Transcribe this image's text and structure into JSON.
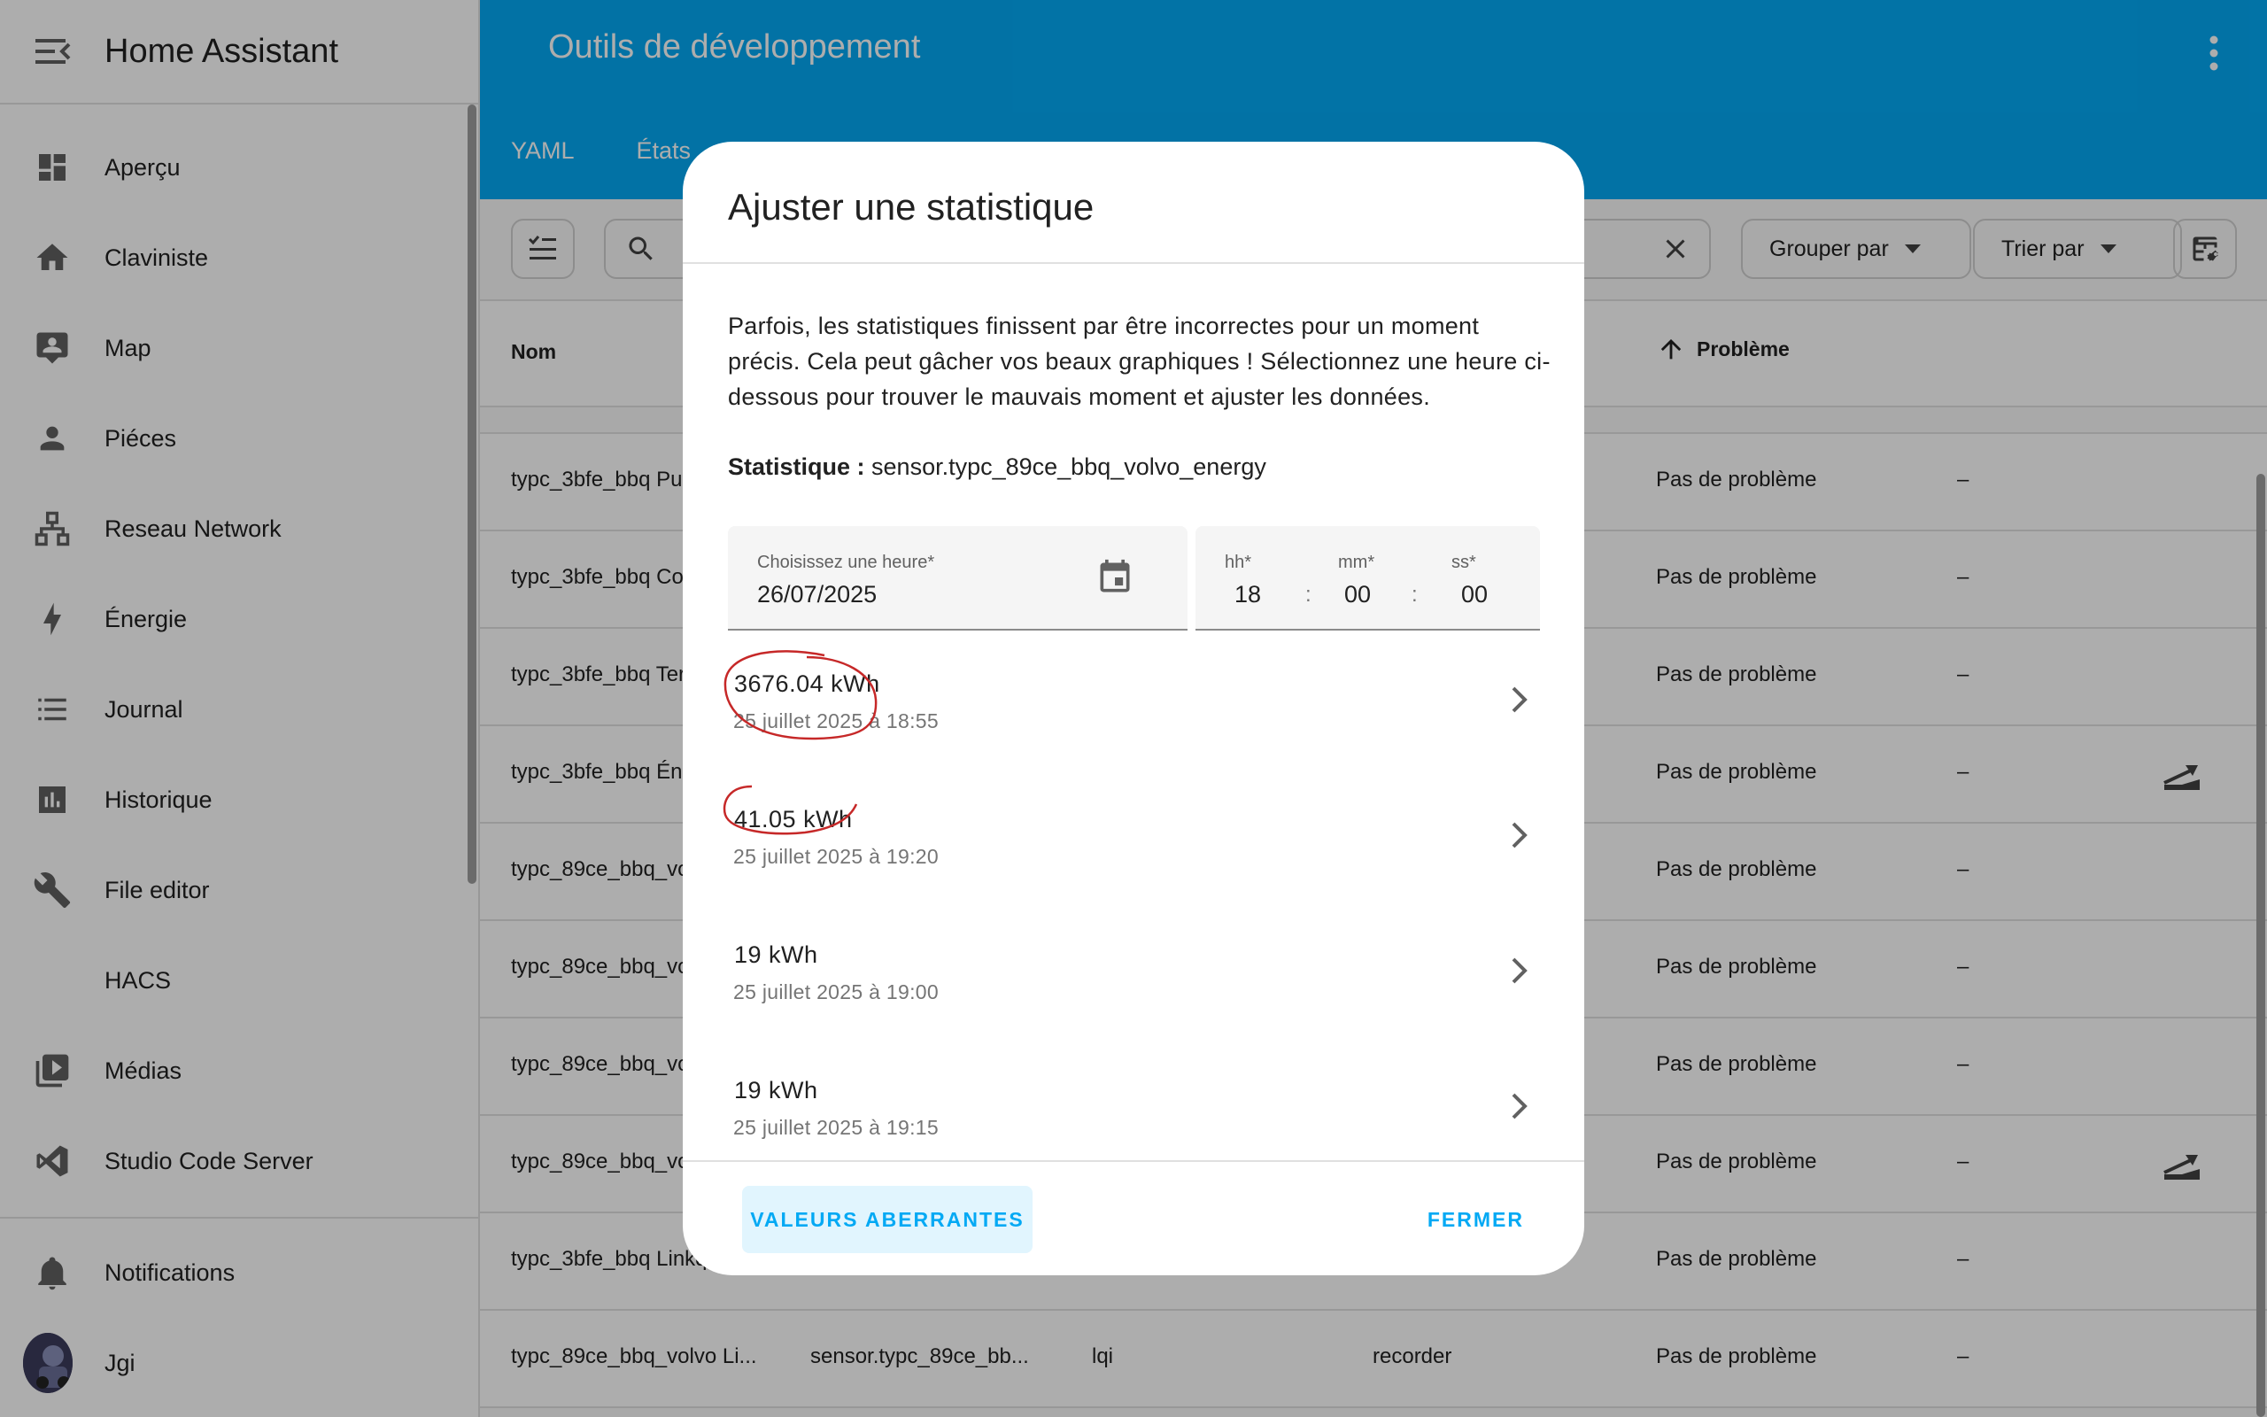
{
  "app_title": "Home Assistant",
  "header": {
    "title": "Outils de développement",
    "tabs": [
      "YAML",
      "États"
    ]
  },
  "sidebar": {
    "items": [
      {
        "label": "Aperçu",
        "icon": "dashboard-icon"
      },
      {
        "label": "Claviniste",
        "icon": "home-icon"
      },
      {
        "label": "Map",
        "icon": "map-account-icon"
      },
      {
        "label": "Piéces",
        "icon": "person-icon"
      },
      {
        "label": "Reseau Network",
        "icon": "network-icon"
      },
      {
        "label": "Énergie",
        "icon": "lightning-icon"
      },
      {
        "label": "Journal",
        "icon": "list-icon"
      },
      {
        "label": "Historique",
        "icon": "chart-icon"
      },
      {
        "label": "File editor",
        "icon": "wrench-icon"
      },
      {
        "label": "HACS",
        "icon": ""
      },
      {
        "label": "Médias",
        "icon": "media-icon"
      },
      {
        "label": "Studio Code Server",
        "icon": "vscode-icon"
      }
    ],
    "notifications": "Notifications",
    "user": "Jgi"
  },
  "toolbar": {
    "group_by": "Grouper par",
    "sort_by": "Trier par"
  },
  "table": {
    "headers": {
      "name": "Nom",
      "problem": "Problème"
    },
    "rows": [
      {
        "name": "typc_3bfe_bbq Pu",
        "entity": "",
        "unit": "",
        "source": "",
        "problem": "Pas de problème",
        "extra": "–",
        "action": false
      },
      {
        "name": "typc_3bfe_bbq Co",
        "entity": "",
        "unit": "",
        "source": "",
        "problem": "Pas de problème",
        "extra": "–",
        "action": false
      },
      {
        "name": "typc_3bfe_bbq Ter",
        "entity": "",
        "unit": "",
        "source": "",
        "problem": "Pas de problème",
        "extra": "–",
        "action": false
      },
      {
        "name": "typc_3bfe_bbq Éne",
        "entity": "",
        "unit": "",
        "source": "",
        "problem": "Pas de problème",
        "extra": "–",
        "action": true
      },
      {
        "name": "typc_89ce_bbq_vo",
        "entity": "",
        "unit": "",
        "source": "",
        "problem": "Pas de problème",
        "extra": "–",
        "action": false
      },
      {
        "name": "typc_89ce_bbq_vo",
        "entity": "",
        "unit": "",
        "source": "",
        "problem": "Pas de problème",
        "extra": "–",
        "action": false
      },
      {
        "name": "typc_89ce_bbq_vo",
        "entity": "",
        "unit": "",
        "source": "",
        "problem": "Pas de problème",
        "extra": "–",
        "action": false
      },
      {
        "name": "typc_89ce_bbq_vo",
        "entity": "",
        "unit": "",
        "source": "",
        "problem": "Pas de problème",
        "extra": "–",
        "action": true
      },
      {
        "name": "typc_3bfe_bbq Linkq",
        "entity": "",
        "unit": "",
        "source": "",
        "problem": "Pas de problème",
        "extra": "–",
        "action": false
      },
      {
        "name": "typc_89ce_bbq_volvo Li...",
        "entity": "sensor.typc_89ce_bb...",
        "unit": "lqi",
        "source": "recorder",
        "problem": "Pas de problème",
        "extra": "–",
        "action": false
      }
    ]
  },
  "dialog": {
    "title": "Ajuster une statistique",
    "description": "Parfois, les statistiques finissent par être incorrectes pour un moment précis. Cela peut gâcher vos beaux graphiques ! Sélectionnez une heure ci-dessous pour trouver le mauvais moment et ajuster les données.",
    "stat_label": "Statistique :",
    "stat_value": "sensor.typc_89ce_bbq_volvo_energy",
    "date_label": "Choisissez une heure*",
    "date_value": "26/07/2025",
    "time": {
      "hh_label": "hh*",
      "hh": "18",
      "mm_label": "mm*",
      "mm": "00",
      "ss_label": "ss*",
      "ss": "00",
      "sep": ":"
    },
    "entries": [
      {
        "value": "3676.04 kWh",
        "date": "25 juillet 2025 à 18:55"
      },
      {
        "value": "41.05 kWh",
        "date": "25 juillet 2025 à 19:20"
      },
      {
        "value": "19 kWh",
        "date": "25 juillet 2025 à 19:00"
      },
      {
        "value": "19 kWh",
        "date": "25 juillet 2025 à 19:15"
      }
    ],
    "outliers_button": "VALEURS ABERRANTES",
    "close_button": "FERMER"
  },
  "colors": {
    "primary": "#03a9f4",
    "annotation": "#c62828"
  }
}
